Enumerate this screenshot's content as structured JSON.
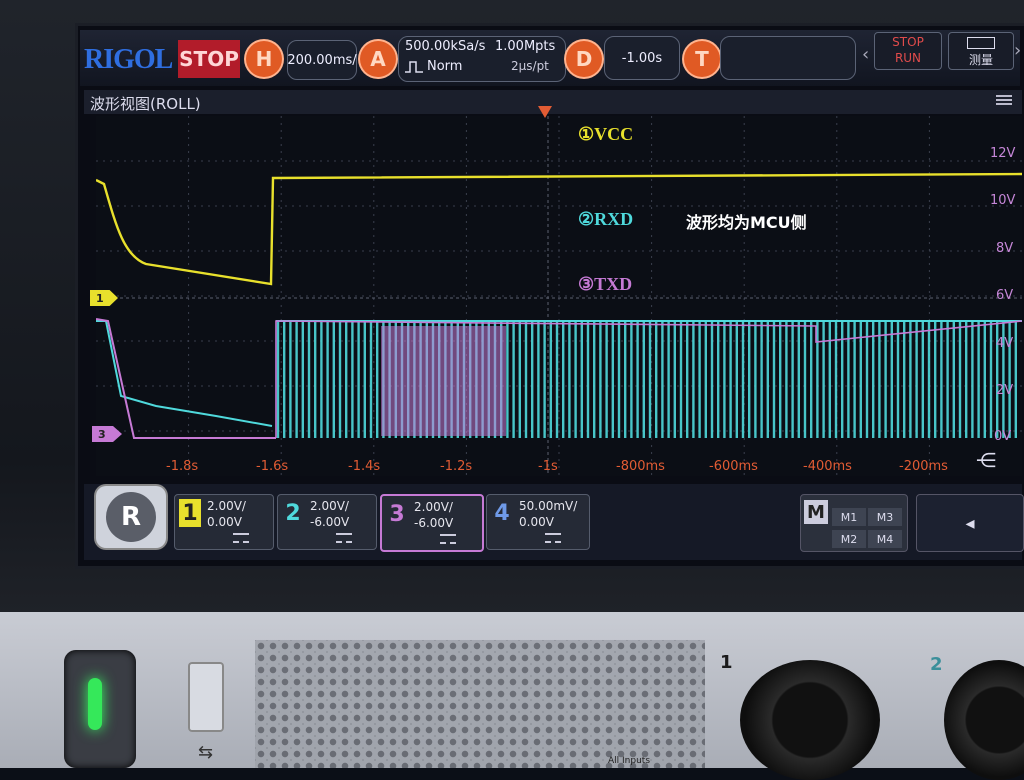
{
  "brand": "RIGOL",
  "run_state": "STOP",
  "topbar": {
    "horizontal": {
      "badge": "H",
      "value": "200.00ms/"
    },
    "acquire": {
      "badge": "A",
      "sample_rate": "500.00kSa/s",
      "memory_depth": "1.00Mpts",
      "trigger_mode": "Norm",
      "time_per_point": "2μs/pt"
    },
    "delay": {
      "badge": "D",
      "value": "-1.00s"
    },
    "trigger": {
      "badge": "T"
    },
    "stop_label": "STOP",
    "run_label": "RUN",
    "measure_label": "测量"
  },
  "window": {
    "title": "波形视图(ROLL)"
  },
  "overlay": {
    "vcc": "①VCC",
    "rxd": "②RXD",
    "txd": "③TXD",
    "note": "波形均为MCU侧"
  },
  "markers": {
    "ch1": "1",
    "ch3": "3"
  },
  "axis": {
    "right_ticks": [
      "12V",
      "10V",
      "8V",
      "6V",
      "4V",
      "2V",
      "0V"
    ],
    "time_ticks": [
      "-1.8s",
      "-1.6s",
      "-1.4s",
      "-1.2s",
      "-1s",
      "-800ms",
      "-600ms",
      "-400ms",
      "-200ms"
    ]
  },
  "channels": [
    {
      "num": "1",
      "scale": "2.00V/",
      "offset": "0.00V",
      "color": "#e8e02c"
    },
    {
      "num": "2",
      "scale": "2.00V/",
      "offset": "-6.00V",
      "color": "#4fd9dc"
    },
    {
      "num": "3",
      "scale": "2.00V/",
      "offset": "-6.00V",
      "color": "#c67ad5"
    },
    {
      "num": "4",
      "scale": "50.00mV/",
      "offset": "0.00V",
      "color": "#4d7fe0"
    }
  ],
  "math": {
    "label": "M",
    "buttons": [
      "M1",
      "M3",
      "M2",
      "M4"
    ]
  },
  "hardware": {
    "bnc1_label": "1",
    "bnc2_label": "2",
    "inputs_label": "All Inputs"
  },
  "colors": {
    "vcc": "#e8e02c",
    "rxd": "#4fd9dc",
    "txd": "#c67ad5",
    "timebase": "#e25c34",
    "brand": "#2f6ee0"
  }
}
